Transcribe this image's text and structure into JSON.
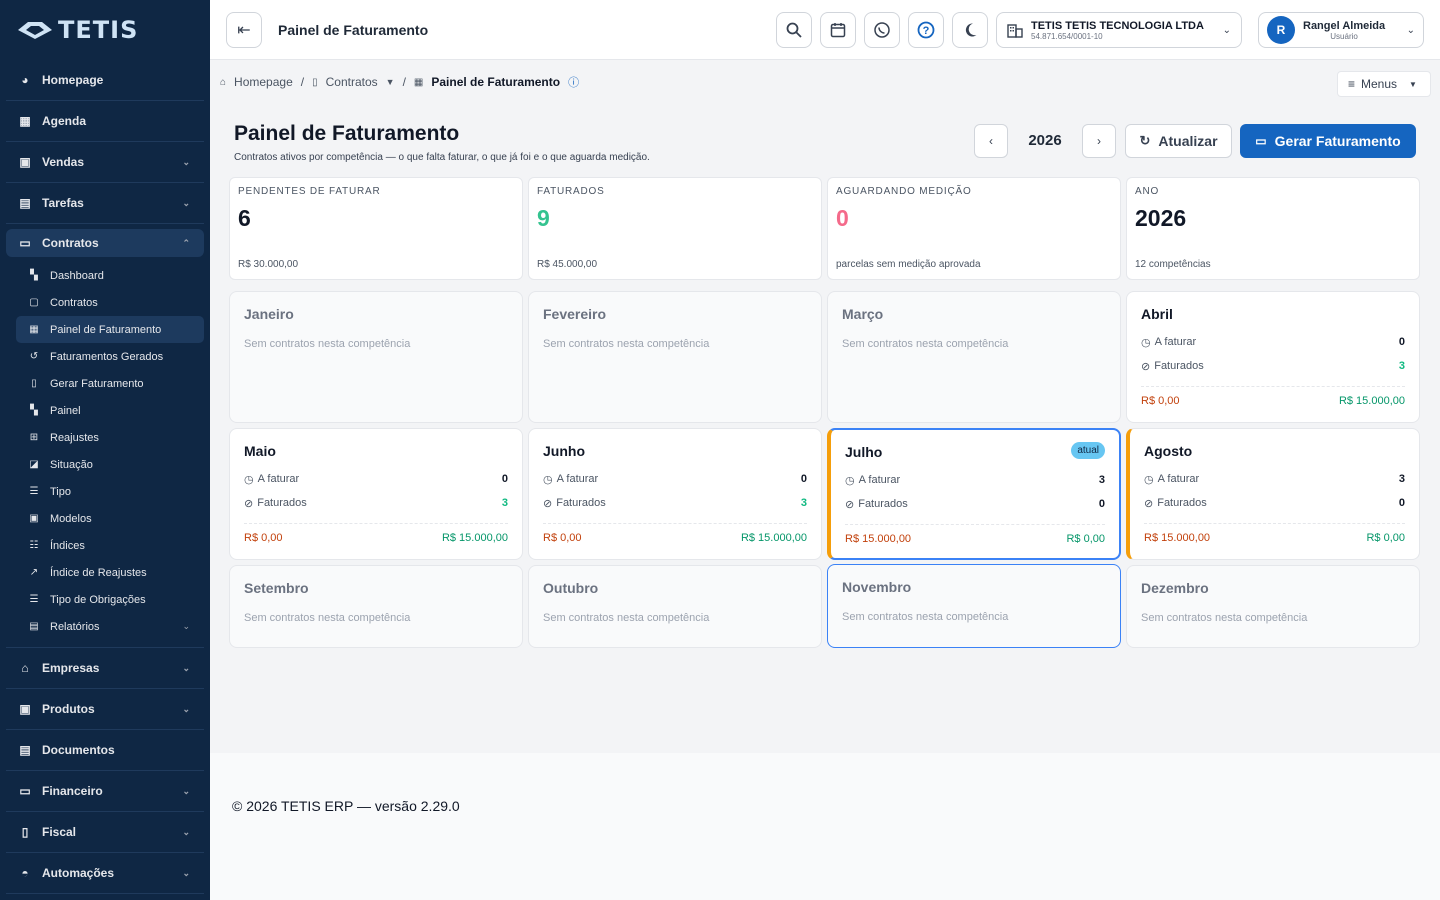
{
  "brand": "TETIS",
  "sidebar": {
    "items": [
      {
        "label": "Homepage"
      },
      {
        "label": "Agenda"
      },
      {
        "label": "Vendas"
      },
      {
        "label": "Tarefas"
      },
      {
        "label": "Contratos"
      },
      {
        "label": "Empresas"
      },
      {
        "label": "Produtos"
      },
      {
        "label": "Documentos"
      },
      {
        "label": "Financeiro"
      },
      {
        "label": "Fiscal"
      },
      {
        "label": "Automações"
      }
    ],
    "contratos_sub": [
      "Dashboard",
      "Contratos",
      "Painel de Faturamento",
      "Faturamentos Gerados",
      "Gerar Faturamento",
      "Painel",
      "Reajustes",
      "Situação",
      "Tipo",
      "Modelos",
      "Índices",
      "Índice de Reajustes",
      "Tipo de Obrigações",
      "Relatórios"
    ]
  },
  "topbar": {
    "title": "Painel de Faturamento",
    "company_name": "TETIS TETIS TECNOLOGIA LTDA",
    "company_cnpj": "54.871.654/0001-10",
    "user_initial": "R",
    "user_name": "Rangel Almeida",
    "user_role": "Usuário"
  },
  "breadcrumb": {
    "home": "Homepage",
    "contratos": "Contratos",
    "current": "Painel de Faturamento"
  },
  "menus_label": "Menus",
  "page": {
    "title": "Painel de Faturamento",
    "subtitle": "Contratos ativos por competência — o que falta faturar, o que já foi e o que aguarda medição.",
    "year": "2026",
    "refresh_label": "Atualizar",
    "gerar_label": "Gerar Faturamento"
  },
  "stats": [
    {
      "label": "PENDENTES DE FATURAR",
      "value": "6",
      "foot": "R$ 30.000,00",
      "color": "#111827"
    },
    {
      "label": "FATURADOS",
      "value": "9",
      "foot": "R$ 45.000,00",
      "color": "#34c38f"
    },
    {
      "label": "AGUARDANDO MEDIÇÃO",
      "value": "0",
      "foot": "parcelas sem medição aprovada",
      "color": "#f46a8a"
    },
    {
      "label": "ANO",
      "value": "2026",
      "foot": "12 competências",
      "color": "#111827"
    }
  ],
  "labels": {
    "a_faturar": "A faturar",
    "faturados": "Faturados",
    "empty": "Sem contratos nesta competência",
    "atual": "atual"
  },
  "months": [
    {
      "name": "Janeiro"
    },
    {
      "name": "Fevereiro"
    },
    {
      "name": "Março"
    },
    {
      "name": "Abril",
      "a_faturar": "0",
      "faturados": "3",
      "v_a": "R$ 0,00",
      "v_b": "R$ 15.000,00"
    },
    {
      "name": "Maio",
      "a_faturar": "0",
      "faturados": "3",
      "v_a": "R$ 0,00",
      "v_b": "R$ 15.000,00"
    },
    {
      "name": "Junho",
      "a_faturar": "0",
      "faturados": "3",
      "v_a": "R$ 0,00",
      "v_b": "R$ 15.000,00"
    },
    {
      "name": "Julho",
      "a_faturar": "3",
      "faturados": "0",
      "v_a": "R$ 15.000,00",
      "v_b": "R$ 0,00"
    },
    {
      "name": "Agosto",
      "a_faturar": "3",
      "faturados": "0",
      "v_a": "R$ 15.000,00",
      "v_b": "R$ 0,00"
    },
    {
      "name": "Setembro"
    },
    {
      "name": "Outubro"
    },
    {
      "name": "Novembro"
    },
    {
      "name": "Dezembro"
    }
  ],
  "footer": "© 2026 TETIS ERP — versão 2.29.0"
}
